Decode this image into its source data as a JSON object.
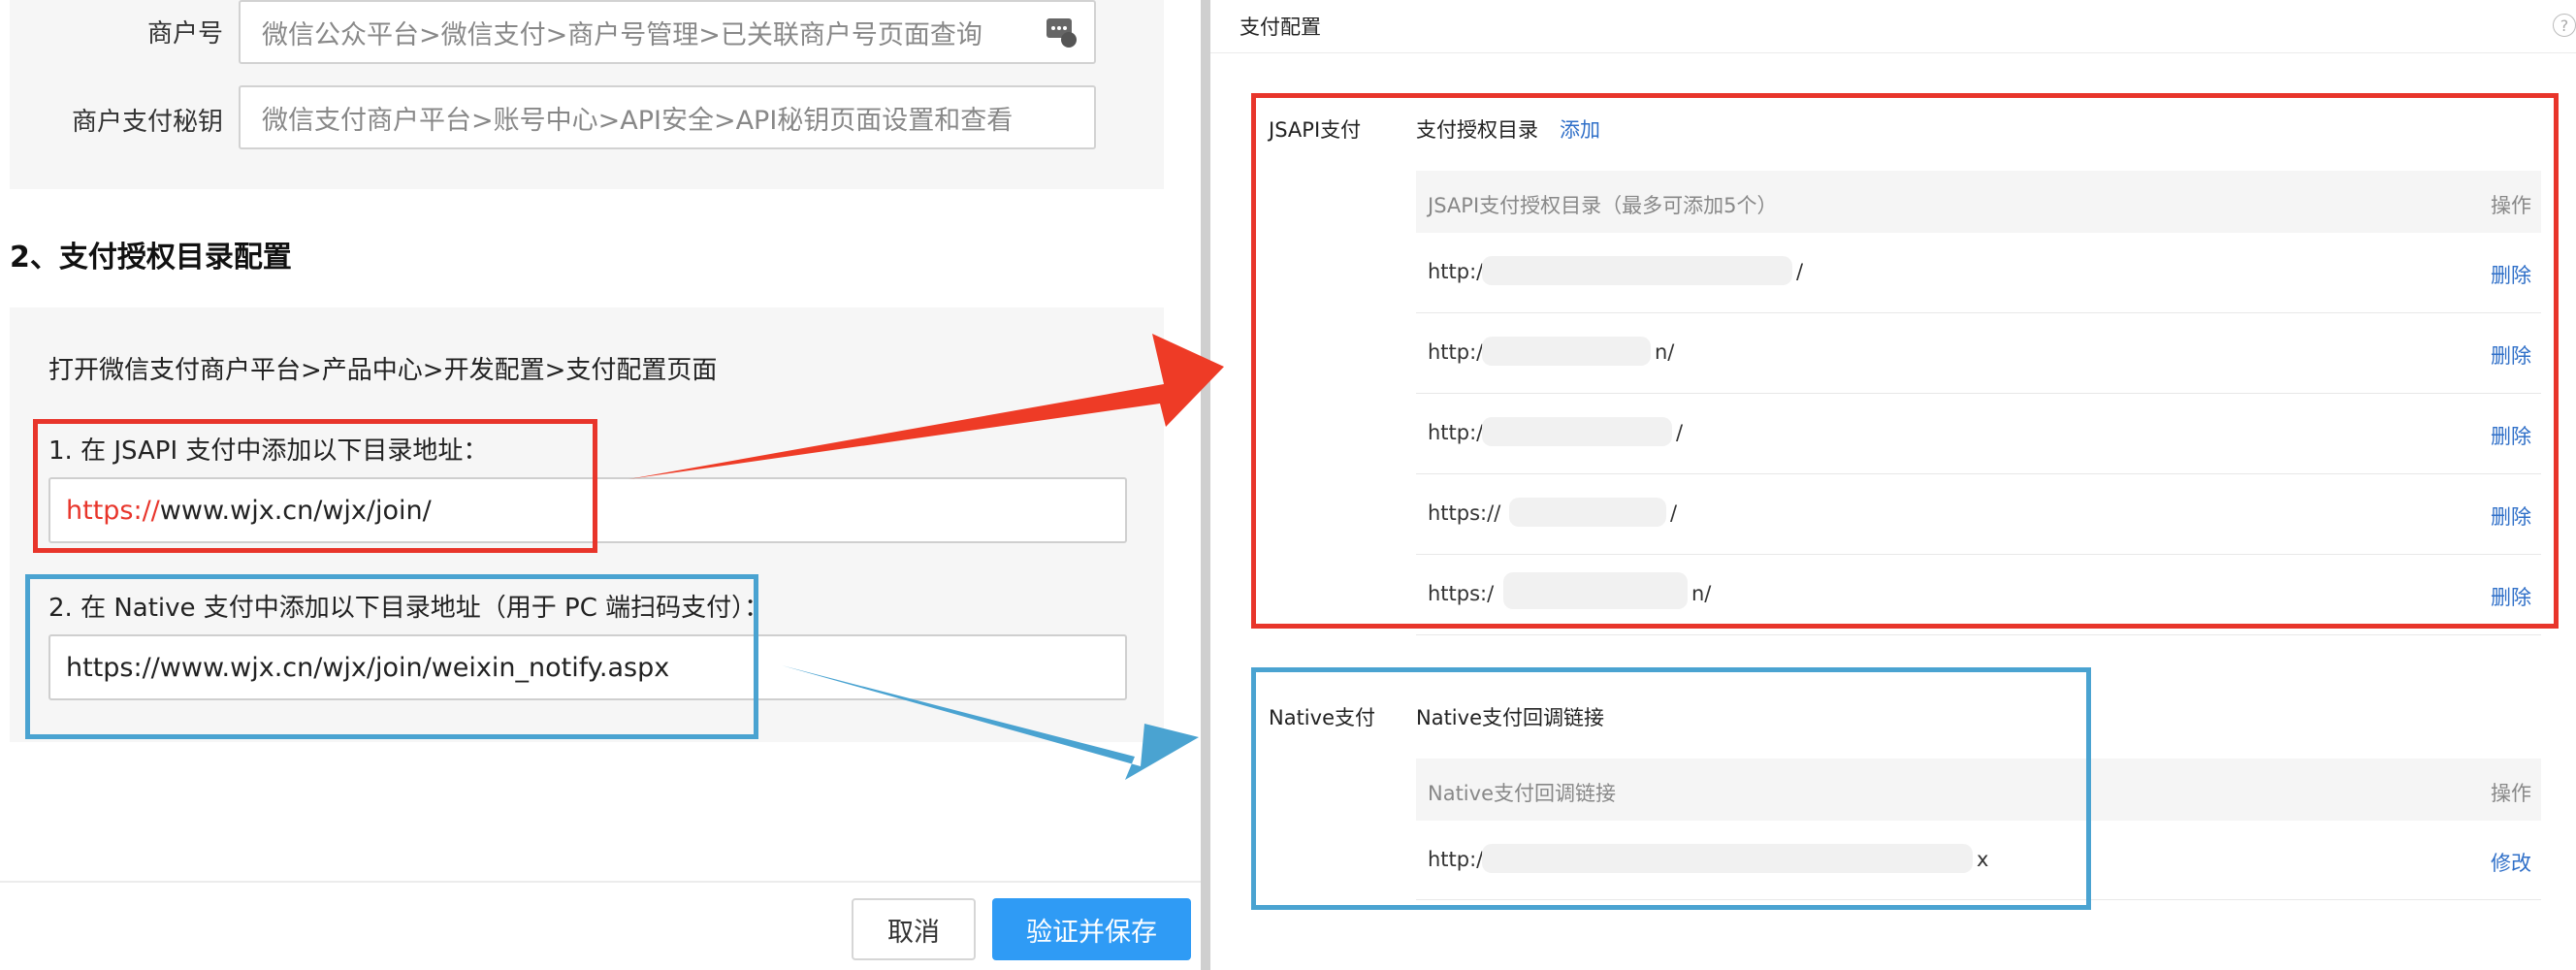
{
  "left": {
    "merchant_id": {
      "label": "商户号",
      "placeholder": "微信公众平台>微信支付>商户号管理>已关联商户号页面查询"
    },
    "merchant_secret": {
      "label": "商户支付秘钥",
      "placeholder": "微信支付商户平台>账号中心>API安全>API秘钥页面设置和查看"
    },
    "section_title": "2、支付授权目录配置",
    "intro": "打开微信支付商户平台>产品中心>开发配置>支付配置页面",
    "step1": "1. 在 JSAPI 支付中添加以下目录地址：",
    "step1_url_prefix": "https://",
    "step1_url_rest": "www.wjx.cn/wjx/join/",
    "step2": "2. 在 Native 支付中添加以下目录地址（用于 PC 端扫码支付）：",
    "step2_url": "https://www.wjx.cn/wjx/join/weixin_notify.aspx",
    "cancel_label": "取消",
    "save_label": "验证并保存"
  },
  "right": {
    "panel_title": "支付配置",
    "jsapi": {
      "label": "JSAPI支付",
      "field_label": "支付授权目录",
      "add_link": "添加",
      "table_header": "JSAPI支付授权目录（最多可添加5个）",
      "action_header": "操作",
      "rows": [
        {
          "prefix": "http:/",
          "suffix": "/",
          "action": "删除"
        },
        {
          "prefix": "http:/",
          "suffix": "n/",
          "action": "删除"
        },
        {
          "prefix": "http:/",
          "suffix": "/",
          "action": "删除"
        },
        {
          "prefix": "https://",
          "suffix": "/",
          "action": "删除"
        },
        {
          "prefix": "https:/",
          "suffix": "n/",
          "action": "删除"
        }
      ]
    },
    "native": {
      "label": "Native支付",
      "field_label": "Native支付回调链接",
      "table_header": "Native支付回调链接",
      "action_header": "操作",
      "row": {
        "prefix": "http:/",
        "suffix": "x",
        "action": "修改"
      }
    }
  },
  "colors": {
    "accent_red": "#e8352b",
    "accent_blue": "#4aa3d1",
    "primary_button": "#2f9bf5",
    "link": "#2f6fc8"
  }
}
